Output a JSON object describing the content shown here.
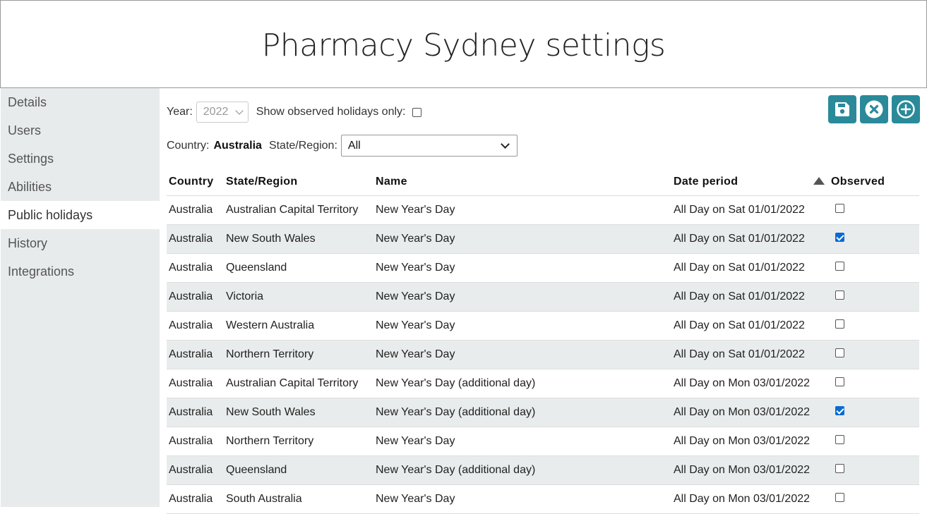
{
  "page": {
    "title": "Pharmacy Sydney settings"
  },
  "sidebar": {
    "items": [
      {
        "label": "Details",
        "active": false
      },
      {
        "label": "Users",
        "active": false
      },
      {
        "label": "Settings",
        "active": false
      },
      {
        "label": "Abilities",
        "active": false
      },
      {
        "label": "Public holidays",
        "active": true
      },
      {
        "label": "History",
        "active": false
      },
      {
        "label": "Integrations",
        "active": false
      }
    ]
  },
  "filters": {
    "year_label": "Year:",
    "year_value": "2022",
    "observed_only_label": "Show observed holidays only:",
    "observed_only_checked": false,
    "country_label": "Country:",
    "country_value": "Australia",
    "state_label": "State/Region:",
    "state_value": "All"
  },
  "toolbar": {
    "save_icon": "save-icon",
    "cancel_icon": "cancel-icon",
    "add_icon": "add-icon",
    "color": "#2a8a9a"
  },
  "table": {
    "headers": {
      "country": "Country",
      "state": "State/Region",
      "name": "Name",
      "date": "Date period",
      "observed": "Observed"
    },
    "sort_indicator": "ascending",
    "rows": [
      {
        "country": "Australia",
        "state": "Australian Capital Territory",
        "name": "New Year's Day",
        "date": "All Day on Sat 01/01/2022",
        "observed": false
      },
      {
        "country": "Australia",
        "state": "New South Wales",
        "name": "New Year's Day",
        "date": "All Day on Sat 01/01/2022",
        "observed": true
      },
      {
        "country": "Australia",
        "state": "Queensland",
        "name": "New Year's Day",
        "date": "All Day on Sat 01/01/2022",
        "observed": false
      },
      {
        "country": "Australia",
        "state": "Victoria",
        "name": "New Year's Day",
        "date": "All Day on Sat 01/01/2022",
        "observed": false
      },
      {
        "country": "Australia",
        "state": "Western Australia",
        "name": "New Year's Day",
        "date": "All Day on Sat 01/01/2022",
        "observed": false
      },
      {
        "country": "Australia",
        "state": "Northern Territory",
        "name": "New Year's Day",
        "date": "All Day on Sat 01/01/2022",
        "observed": false
      },
      {
        "country": "Australia",
        "state": "Australian Capital Territory",
        "name": "New Year's Day (additional day)",
        "date": "All Day on Mon 03/01/2022",
        "observed": false
      },
      {
        "country": "Australia",
        "state": "New South Wales",
        "name": "New Year's Day (additional day)",
        "date": "All Day on Mon 03/01/2022",
        "observed": true
      },
      {
        "country": "Australia",
        "state": "Northern Territory",
        "name": "New Year's Day",
        "date": "All Day on Mon 03/01/2022",
        "observed": false
      },
      {
        "country": "Australia",
        "state": "Queensland",
        "name": "New Year's Day (additional day)",
        "date": "All Day on Mon 03/01/2022",
        "observed": false
      },
      {
        "country": "Australia",
        "state": "South Australia",
        "name": "New Year's Day",
        "date": "All Day on Mon 03/01/2022",
        "observed": false
      }
    ]
  }
}
